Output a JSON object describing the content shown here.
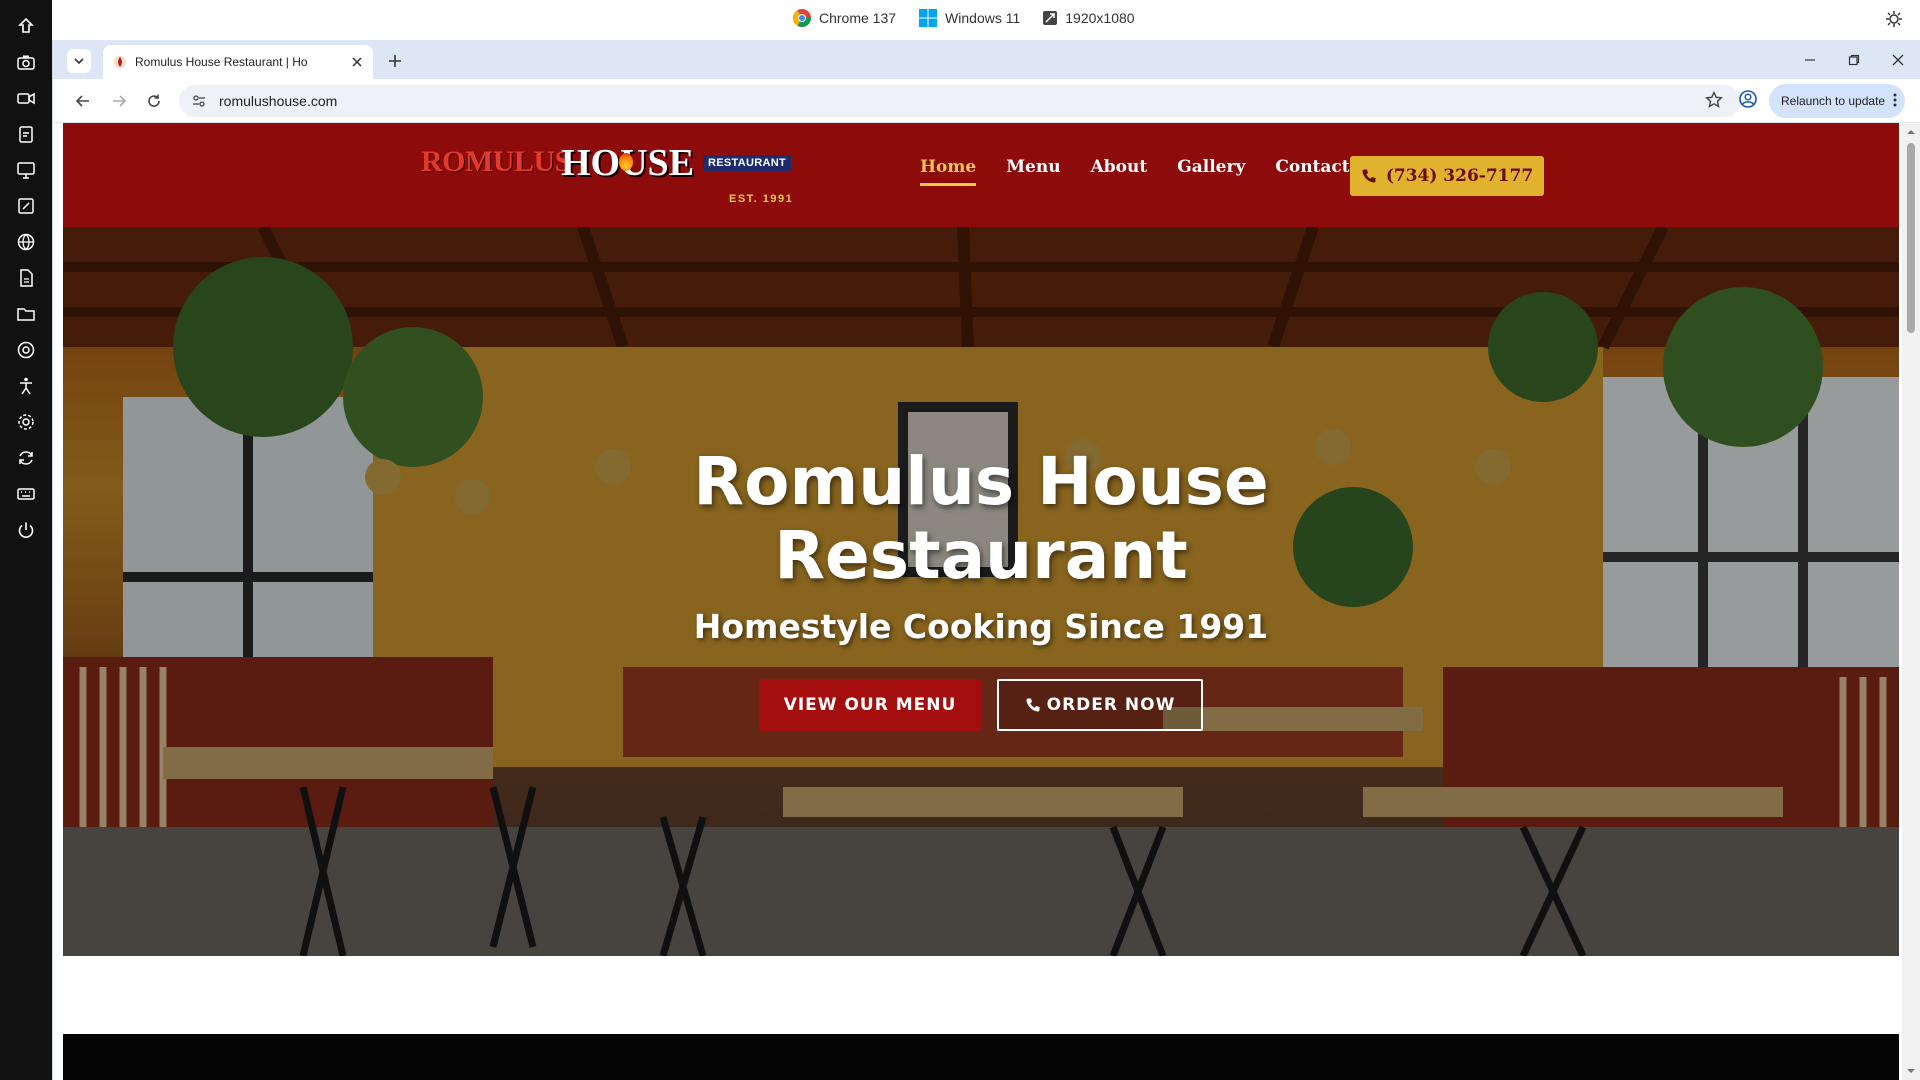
{
  "system_bar": {
    "browser": "Chrome 137",
    "os": "Windows 11",
    "resolution": "1920x1080"
  },
  "left_toolbar": {
    "icons": [
      "logo-icon",
      "camera-icon",
      "video-icon",
      "clipboard-icon",
      "monitor-icon",
      "edit-icon",
      "globe-icon",
      "document-icon",
      "folder-icon",
      "chrome-icon",
      "accessibility-icon",
      "settings-icon",
      "sync-icon",
      "keyboard-icon",
      "power-icon"
    ]
  },
  "browser": {
    "tab_title": "Romulus House Restaurant | Ho",
    "url": "romulushouse.com",
    "relaunch_label": "Relaunch to update"
  },
  "site": {
    "logo": {
      "romulus": "ROMULUS",
      "house": "HOUSE",
      "badge": "RESTAURANT",
      "est": "EST. 1991"
    },
    "nav": {
      "home": "Home",
      "menu": "Menu",
      "about": "About",
      "gallery": "Gallery",
      "contact": "Contact"
    },
    "phone": "(734) 326-7177",
    "hero": {
      "title_line1": "Romulus House",
      "title_line2": "Restaurant",
      "subtitle": "Homestyle Cooking Since 1991",
      "menu_button": "VIEW OUR MENU",
      "order_button": "ORDER NOW"
    }
  },
  "colors": {
    "header_red": "#8d0b0b",
    "accent_gold": "#e0b22e",
    "button_red": "#a40e0e"
  }
}
